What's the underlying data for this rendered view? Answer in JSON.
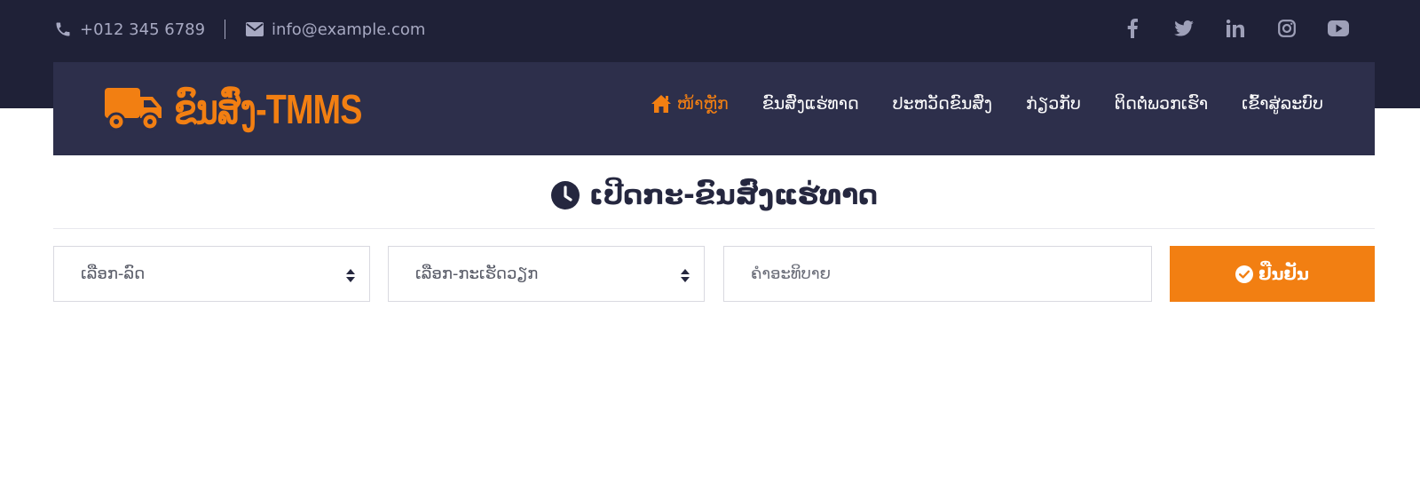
{
  "topbar": {
    "phone": "+012 345 6789",
    "email": "info@example.com",
    "social_icons": [
      "facebook-icon",
      "twitter-icon",
      "linkedin-icon",
      "instagram-icon",
      "youtube-icon"
    ]
  },
  "brand": {
    "name": "ຂົນສົ່ງ-TMMS",
    "icon": "truck-icon"
  },
  "nav": {
    "items": [
      {
        "label": "ໜ້າຫຼັກ",
        "active": true,
        "icon": "home-icon"
      },
      {
        "label": "ຂົນສົ່ງແຮ່ທາດ"
      },
      {
        "label": "ປະຫວັດຂົນສົ່ງ"
      },
      {
        "label": "ກ່ຽວກັບ"
      },
      {
        "label": "ຕິດຕໍ່ພວກເຮົາ"
      },
      {
        "label": "ເຂົ້າສູ່ລະບົບ"
      }
    ]
  },
  "page": {
    "title": "ເປີດກະ-ຂົນສົ່ງແຮ່ທາດ",
    "title_icon": "clock-icon"
  },
  "form": {
    "car_select": {
      "value": "ເລືອກ-ລົດ"
    },
    "work_select": {
      "value": "ເລືອກ-ກະເຮັດວຽກ"
    },
    "description": {
      "placeholder": "ຄຳອະທິບາຍ"
    },
    "confirm_label": "ຢືນຢັນ"
  },
  "colors": {
    "topbar": "#1f2137",
    "navbar": "#2d2f4b",
    "accent": "#f27f12",
    "text_dark": "#25273f"
  }
}
